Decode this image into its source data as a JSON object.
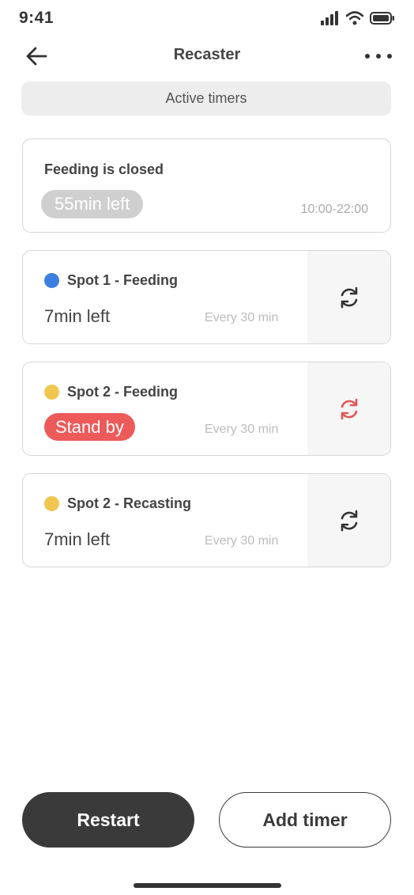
{
  "status_bar": {
    "time": "9:41"
  },
  "nav": {
    "title": "Recaster"
  },
  "section": {
    "label": "Active timers"
  },
  "cards": [
    {
      "title": "Feeding is closed",
      "pill": "55min left",
      "hours": "10:00-22:00"
    },
    {
      "title": "Spot 1 - Feeding",
      "status": "7min left",
      "interval": "Every 30 min",
      "dot_color": "#3d7fe0",
      "icon_color": "#333333"
    },
    {
      "title": "Spot 2 - Feeding",
      "status": "Stand by",
      "interval": "Every 30 min",
      "dot_color": "#f0c64f",
      "icon_color": "#e05656"
    },
    {
      "title": "Spot 2 - Recasting",
      "status": "7min left",
      "interval": "Every 30 min",
      "dot_color": "#f0c64f",
      "icon_color": "#333333"
    }
  ],
  "actions": {
    "restart": "Restart",
    "add_timer": "Add timer"
  },
  "icons": {
    "back": "arrow-left-icon",
    "more": "more-dots-icon",
    "refresh": "refresh-icon"
  }
}
